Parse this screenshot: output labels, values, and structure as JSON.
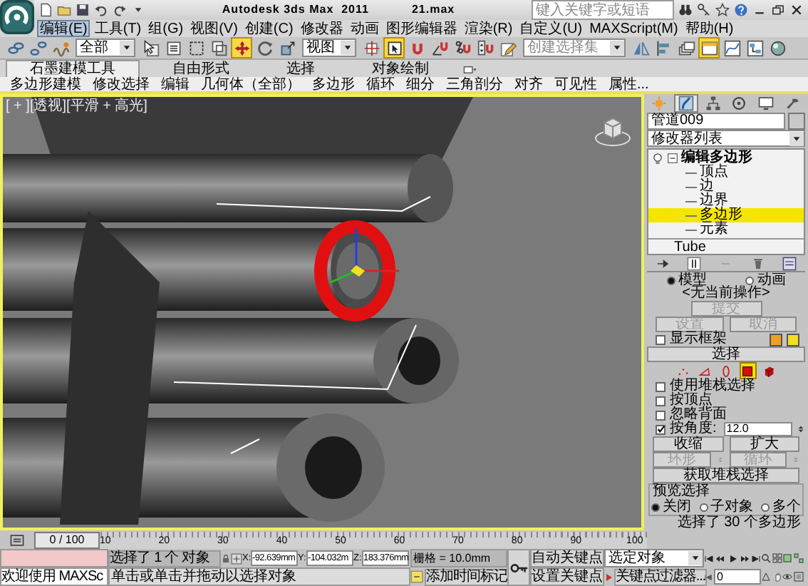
{
  "title_bar": {
    "title": "Autodesk 3ds Max  2011",
    "file": "21.max",
    "search": {
      "placeholder": "键入关键字或短语"
    }
  },
  "menu": [
    {
      "label": "编辑(E)",
      "selected": true
    },
    {
      "label": "工具(T)",
      "selected": false
    },
    {
      "label": "组(G)",
      "selected": false
    },
    {
      "label": "视图(V)",
      "selected": false
    },
    {
      "label": "创建(C)",
      "selected": false
    },
    {
      "label": "修改器",
      "selected": false
    },
    {
      "label": "动画",
      "selected": false
    },
    {
      "label": "图形编辑器",
      "selected": false
    },
    {
      "label": "渲染(R)",
      "selected": false
    },
    {
      "label": "自定义(U)",
      "selected": false
    },
    {
      "label": "MAXScript(M)",
      "selected": false
    },
    {
      "label": "帮助(H)",
      "selected": false
    }
  ],
  "main_toolbar": {
    "tools_a": [
      {
        "kind": "link",
        "selected": false
      },
      {
        "kind": "unlink",
        "selected": false
      },
      {
        "kind": "bind",
        "selected": false
      }
    ],
    "selection_filter": "全部",
    "tools_b": [
      {
        "kind": "select",
        "selected": false
      },
      {
        "kind": "select_name",
        "selected": false
      },
      {
        "kind": "rect_region",
        "selected": false
      },
      {
        "kind": "window_crossing",
        "selected": false
      },
      {
        "kind": "move",
        "selected": true
      },
      {
        "kind": "rotate",
        "selected": false
      },
      {
        "kind": "scale",
        "selected": false
      }
    ],
    "coordinate_system": "视图",
    "tools_c": [
      {
        "kind": "pivot",
        "selected": false
      },
      {
        "kind": "manipulate",
        "selected": true
      },
      {
        "kind": "snap",
        "selected": false
      },
      {
        "kind": "angle_snap",
        "selected": false
      },
      {
        "kind": "percent_snap",
        "selected": false
      },
      {
        "kind": "spinner_snap",
        "selected": false
      },
      {
        "kind": "named_sel",
        "selected": false
      }
    ],
    "named_selection": {
      "placeholder": "创建选择集"
    },
    "tools_d": [
      {
        "kind": "mirror",
        "selected": false
      },
      {
        "kind": "align",
        "selected": false
      },
      {
        "kind": "layer",
        "selected": false
      },
      {
        "kind": "graphite",
        "selected": true
      },
      {
        "kind": "curve_editor",
        "selected": false
      },
      {
        "kind": "schematic",
        "selected": false
      },
      {
        "kind": "material",
        "selected": false
      }
    ]
  },
  "ribbon": {
    "tabs": [
      {
        "label": "石墨建模工具",
        "selected": true
      },
      {
        "label": "自由形式",
        "selected": false
      },
      {
        "label": "选择",
        "selected": false
      },
      {
        "label": "对象绘制",
        "selected": false
      }
    ],
    "panels": [
      "多边形建模",
      "修改选择",
      "编辑",
      "几何体（全部）",
      "多边形",
      "循环",
      "细分",
      "三角剖分",
      "对齐",
      "可见性",
      "属性..."
    ]
  },
  "viewport": {
    "label": "[ + ][透视][平滑 + 高光]",
    "active": true
  },
  "command_panel": {
    "tabs": [
      {
        "kind": "create",
        "selected": false
      },
      {
        "kind": "modify",
        "selected": true
      },
      {
        "kind": "hierarchy",
        "selected": false
      },
      {
        "kind": "motion",
        "selected": false
      },
      {
        "kind": "display",
        "selected": false
      },
      {
        "kind": "utilities",
        "selected": false
      }
    ],
    "object_name": "管道009",
    "modifier_list": "修改器列表",
    "stack": [
      {
        "label": "编辑多边形",
        "kind": "modifier",
        "expanded": true,
        "selected": false,
        "children": [
          {
            "label": "顶点",
            "selected": false
          },
          {
            "label": "边",
            "selected": false
          },
          {
            "label": "边界",
            "selected": false
          },
          {
            "label": "多边形",
            "selected": true
          },
          {
            "label": "元素",
            "selected": false
          }
        ]
      },
      {
        "label": "Tube",
        "kind": "object",
        "selected": false
      }
    ],
    "edit_geometry": {
      "modes": [
        {
          "label": "模型",
          "selected": true
        },
        {
          "label": "动画",
          "selected": false
        }
      ],
      "current_operation": "<无当前操作>",
      "commit": {
        "label": "提交",
        "disabled": true
      },
      "buttons": [
        {
          "label": "设置",
          "disabled": true
        },
        {
          "label": "取消",
          "disabled": true
        }
      ],
      "show_cage": {
        "label": "显示框架",
        "checked": false
      },
      "cage_colors": [
        {
          "color": "#f0a020"
        },
        {
          "color": "#f4e020"
        }
      ]
    },
    "selection": {
      "title": "选择",
      "levels": [
        {
          "kind": "vertex",
          "selected": false
        },
        {
          "kind": "edge",
          "selected": false
        },
        {
          "kind": "border",
          "selected": false
        },
        {
          "kind": "polygon",
          "selected": true
        },
        {
          "kind": "element",
          "selected": false
        }
      ],
      "options": [
        {
          "label": "使用堆栈选择",
          "checked": false
        },
        {
          "label": "按顶点",
          "checked": false
        },
        {
          "label": "忽略背面",
          "checked": false
        },
        {
          "label": "按角度:",
          "checked": true,
          "value": "12.0"
        }
      ],
      "grow_shrink": [
        {
          "label": "收缩",
          "disabled": false
        },
        {
          "label": "扩大",
          "disabled": false
        }
      ],
      "ring_loop": [
        {
          "label": "环形",
          "disabled": true
        },
        {
          "label": "循环",
          "disabled": true
        }
      ],
      "get_stack": "获取堆栈选择",
      "preview": {
        "title": "预览选择",
        "options": [
          {
            "label": "关闭",
            "selected": true
          },
          {
            "label": "子对象",
            "selected": false
          },
          {
            "label": "多个",
            "selected": false
          }
        ]
      },
      "status": "选择了 30 个多边形"
    }
  },
  "timeline": {
    "slider": "0 / 100",
    "ticks": [
      "10",
      "20",
      "30",
      "40",
      "50",
      "60",
      "70",
      "80",
      "90",
      "100"
    ]
  },
  "status_bar": {
    "maxscript": "欢迎使用 MAXSc",
    "selection_info": "选择了 1 个 对象",
    "prompt": "单击或单击并拖动以选择对象",
    "coords": [
      {
        "label": "X:",
        "value": "-92.639mm"
      },
      {
        "label": "Y:",
        "value": "-104.032m"
      },
      {
        "label": "Z:",
        "value": "183.376mm"
      }
    ],
    "grid": "栅格 = 10.0mm",
    "add_time_tag": "添加时间标记",
    "auto_key": "自动关键点",
    "set_key": "设置关键点",
    "key_object": "选定对象",
    "key_filters": "关键点过滤器...",
    "current_frame": "0"
  }
}
